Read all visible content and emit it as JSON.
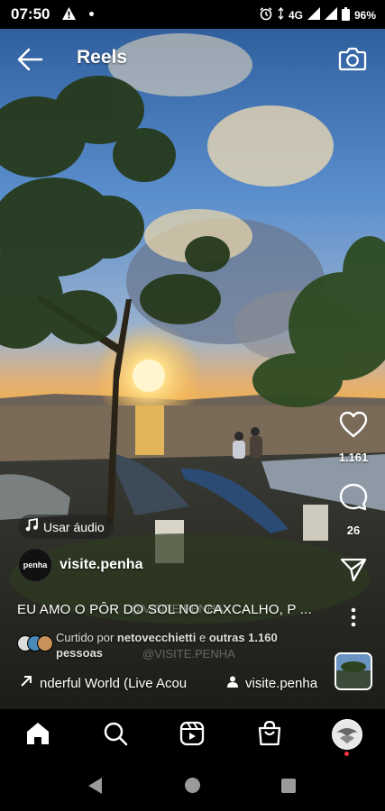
{
  "status": {
    "time": "07:50",
    "network": "4G",
    "battery": "96%"
  },
  "header": {
    "title": "Reels"
  },
  "actions": {
    "likes": "1.161",
    "comments": "26"
  },
  "audio_chip": {
    "label": "Usar áudio"
  },
  "account": {
    "avatar_text": "penha",
    "username": "visite.penha"
  },
  "caption": {
    "text": "EU AMO O PÔR DO SOL NO CAXCALHO, P ..."
  },
  "liked_by": {
    "prefix": "Curtido por ",
    "user": "netovecchietti",
    "middle": " e ",
    "others": "outras 1.160",
    "suffix": "pessoas"
  },
  "watermark": "@VISITE.PENHA",
  "music": {
    "track": "nderful World (Live Acou",
    "artist": "visite.penha"
  },
  "colors": {
    "accent_dot": "#ff3040"
  }
}
